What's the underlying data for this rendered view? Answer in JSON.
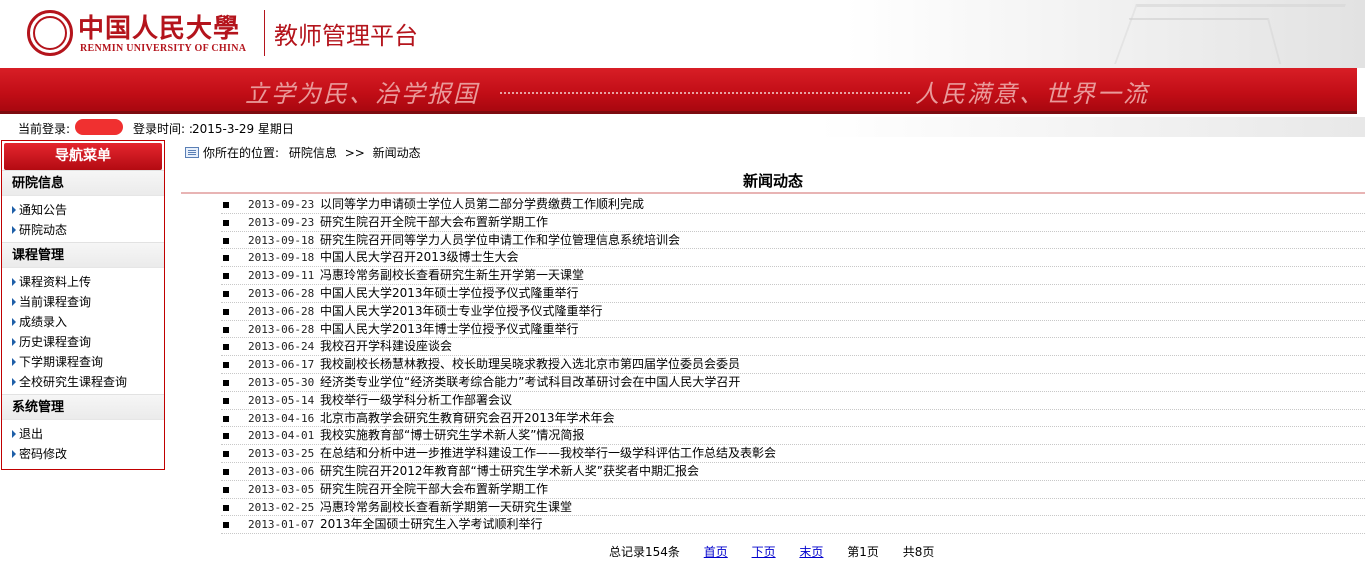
{
  "header": {
    "logo_cn": "中国人民大學",
    "logo_en": "RENMIN UNIVERSITY OF CHINA",
    "platform_title": "教师管理平台"
  },
  "banner": {
    "left_slogan": "立学为民、治学报国",
    "right_slogan": "人民满意、世界一流"
  },
  "status": {
    "login_label": "当前登录:",
    "time_label": "登录时间: :",
    "time_value": "2015-3-29 星期日"
  },
  "sidebar": {
    "header": "导航菜单",
    "sections": [
      {
        "title": "研院信息",
        "items": [
          "通知公告",
          "研院动态"
        ]
      },
      {
        "title": "课程管理",
        "items": [
          "课程资料上传",
          "当前课程查询",
          "成绩录入",
          "历史课程查询",
          "下学期课程查询",
          "全校研究生课程查询"
        ]
      },
      {
        "title": "系统管理",
        "items": [
          "退出",
          "密码修改"
        ]
      }
    ]
  },
  "breadcrumb": {
    "prefix": "你所在的位置:",
    "level1": "研院信息",
    "separator": ">>",
    "level2": "新闻动态"
  },
  "main": {
    "title": "新闻动态",
    "news": [
      {
        "date": "2013-09-23",
        "title": "以同等学力申请硕士学位人员第二部分学费缴费工作顺利完成"
      },
      {
        "date": "2013-09-23",
        "title": "研究生院召开全院干部大会布置新学期工作"
      },
      {
        "date": "2013-09-18",
        "title": "研究生院召开同等学力人员学位申请工作和学位管理信息系统培训会"
      },
      {
        "date": "2013-09-18",
        "title": "中国人民大学召开2013级博士生大会"
      },
      {
        "date": "2013-09-11",
        "title": "冯惠玲常务副校长查看研究生新生开学第一天课堂"
      },
      {
        "date": "2013-06-28",
        "title": "中国人民大学2013年硕士学位授予仪式隆重举行"
      },
      {
        "date": "2013-06-28",
        "title": "中国人民大学2013年硕士专业学位授予仪式隆重举行"
      },
      {
        "date": "2013-06-28",
        "title": "中国人民大学2013年博士学位授予仪式隆重举行"
      },
      {
        "date": "2013-06-24",
        "title": "我校召开学科建设座谈会"
      },
      {
        "date": "2013-06-17",
        "title": "我校副校长杨慧林教授、校长助理吴晓求教授入选北京市第四届学位委员会委员"
      },
      {
        "date": "2013-05-30",
        "title": "经济类专业学位“经济类联考综合能力”考试科目改革研讨会在中国人民大学召开"
      },
      {
        "date": "2013-05-14",
        "title": "我校举行一级学科分析工作部署会议"
      },
      {
        "date": "2013-04-16",
        "title": "北京市高教学会研究生教育研究会召开2013年学术年会"
      },
      {
        "date": "2013-04-01",
        "title": "我校实施教育部“博士研究生学术新人奖”情况简报"
      },
      {
        "date": "2013-03-25",
        "title": "在总结和分析中进一步推进学科建设工作——我校举行一级学科评估工作总结及表彰会"
      },
      {
        "date": "2013-03-06",
        "title": "研究生院召开2012年教育部“博士研究生学术新人奖”获奖者中期汇报会"
      },
      {
        "date": "2013-03-05",
        "title": "研究生院召开全院干部大会布置新学期工作"
      },
      {
        "date": "2013-02-25",
        "title": "冯惠玲常务副校长查看新学期第一天研究生课堂"
      },
      {
        "date": "2013-01-07",
        "title": "2013年全国硕士研究生入学考试顺利举行"
      }
    ]
  },
  "pager": {
    "total": "总记录154条",
    "first": "首页",
    "next": "下页",
    "last": "末页",
    "current": "第1页",
    "count": "共8页"
  },
  "colors": {
    "brand_red": "#b4141c",
    "banner_red": "#c10d16",
    "link_blue": "#0000cc"
  }
}
